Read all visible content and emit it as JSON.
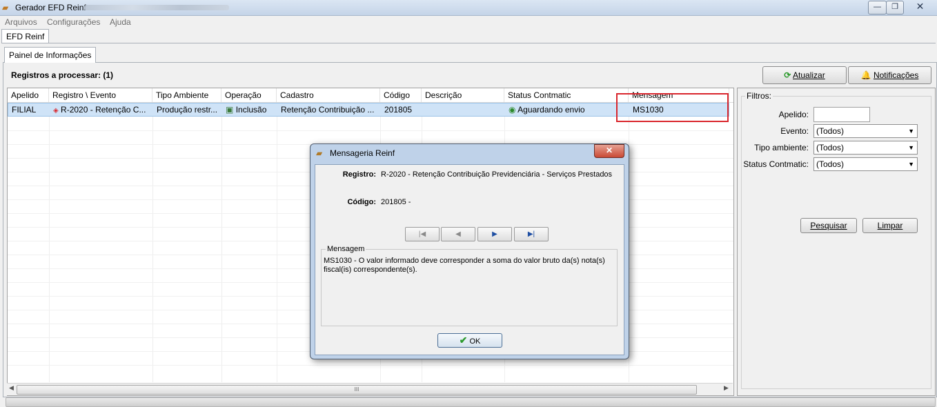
{
  "window": {
    "title": "Gerador EFD Reinf",
    "icon": "folder-icon",
    "controls": {
      "minimize": "—",
      "maximize": "❐",
      "close": "✕"
    }
  },
  "menu": [
    "Arquivos",
    "Configurações",
    "Ajuda"
  ],
  "tabs": {
    "outer": "EFD Reinf",
    "inner": "Painel de Informações"
  },
  "toolbar": {
    "registros": "Registros a processar: (1)",
    "atualizar": "Atualizar",
    "notificacoes": "Notificações"
  },
  "grid": {
    "columns": [
      "Apelido",
      "Registro \\ Evento",
      "Tipo Ambiente",
      "Operação",
      "Cadastro",
      "Código",
      "Descrição",
      "Status Contmatic",
      "Mensagem"
    ],
    "rows": [
      {
        "apelido": "FILIAL",
        "registro": "R-2020 - Retenção C...",
        "tipo_ambiente": "Produção restr...",
        "operacao": "Inclusão",
        "cadastro": "Retenção Contribuição ...",
        "codigo": "201805",
        "descricao": "",
        "status": "Aguardando envio",
        "mensagem": "MS1030"
      }
    ],
    "scroll_thumb": "III"
  },
  "filtros": {
    "legend": "Filtros:",
    "apelido_label": "Apelido:",
    "apelido_value": "",
    "evento_label": "Evento:",
    "evento_value": "(Todos)",
    "tipo_label": "Tipo ambiente:",
    "tipo_value": "(Todos)",
    "status_label": "Status Contmatic:",
    "status_value": "(Todos)",
    "pesquisar": "Pesquisar",
    "limpar": "Limpar"
  },
  "dialog": {
    "title": "Mensageria Reinf",
    "close": "✕",
    "registro_label": "Registro:",
    "registro_value": "R-2020 - Retenção Contribuição Previdenciária - Serviços Prestados",
    "codigo_label": "Código:",
    "codigo_value": "201805 -",
    "nav": {
      "first": "|◀",
      "prev": "◀",
      "next": "▶",
      "last": "▶|"
    },
    "mensagem_legend": "Mensagem",
    "mensagem_text": "MS1030 - O valor informado deve corresponder a soma do valor bruto da(s) nota(s) fiscal(is) correspondente(s).",
    "ok": "OK"
  },
  "colors": {
    "highlight_box": "#d9262d",
    "selected_row": "#cfe3f7"
  }
}
